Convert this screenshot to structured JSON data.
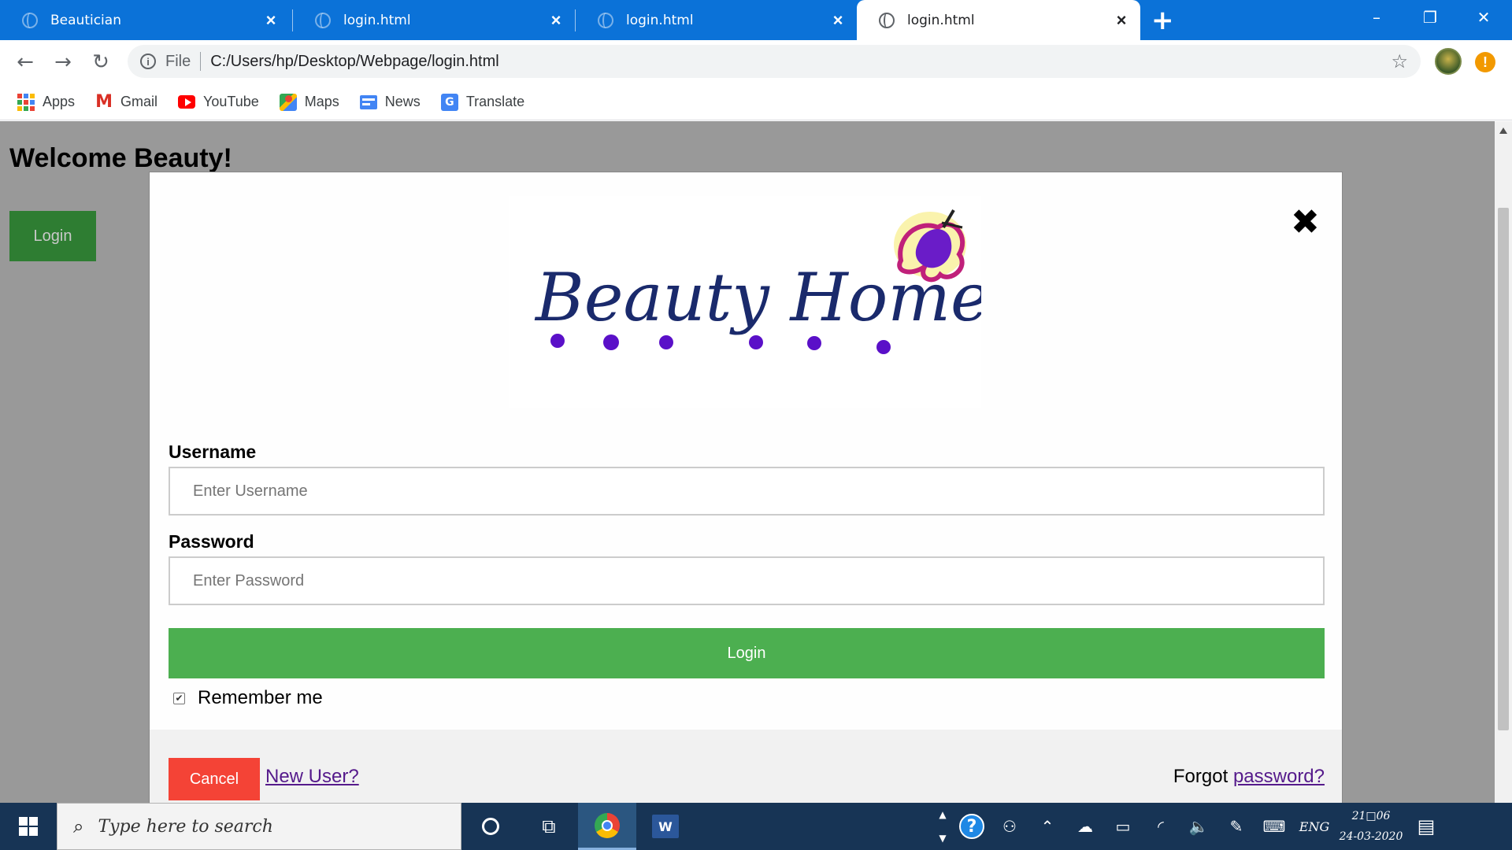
{
  "browser": {
    "tabs": [
      {
        "title": "Beautician"
      },
      {
        "title": "login.html"
      },
      {
        "title": "login.html"
      },
      {
        "title": "login.html"
      }
    ],
    "active_tab_index": 3,
    "new_tab_label": "+",
    "address": {
      "scheme": "File",
      "url": "C:/Users/hp/Desktop/Webpage/login.html"
    },
    "alert_badge": "!",
    "bookmarks": [
      {
        "label": "Apps",
        "icon": "apps-grid-icon"
      },
      {
        "label": "Gmail",
        "icon": "gmail-icon"
      },
      {
        "label": "YouTube",
        "icon": "youtube-icon"
      },
      {
        "label": "Maps",
        "icon": "maps-icon"
      },
      {
        "label": "News",
        "icon": "news-icon"
      },
      {
        "label": "Translate",
        "icon": "translate-icon"
      }
    ]
  },
  "page": {
    "heading": "Welcome Beauty!",
    "login_button": "Login"
  },
  "modal": {
    "logo": {
      "text": "Beauty Home",
      "colors": {
        "text": "#1a2a6c",
        "dots": "#5a10c8",
        "flower": "#c0207a",
        "flower_fill": "#6a1cc8",
        "glow": "#f5e96a"
      }
    },
    "username": {
      "label": "Username",
      "placeholder": "Enter Username"
    },
    "password": {
      "label": "Password",
      "placeholder": "Enter Password"
    },
    "login_button": "Login",
    "remember_me": {
      "label": "Remember me",
      "checked": true
    },
    "footer": {
      "cancel_button": "Cancel",
      "new_user_link": "New User?",
      "forgot_prefix": "Forgot",
      "forgot_link": "password?"
    }
  },
  "taskbar": {
    "search_placeholder": "Type here to search",
    "language": "ENG",
    "time": "21□06",
    "date": "24-03-2020"
  },
  "colors": {
    "chrome_tabstrip": "#0b72d8",
    "page_overlay": "#999999",
    "login_green": "#4caf50",
    "page_login_green": "#2e7d32",
    "cancel_red": "#f44336",
    "link_purple": "#551a8b",
    "taskbar": "#173455"
  }
}
